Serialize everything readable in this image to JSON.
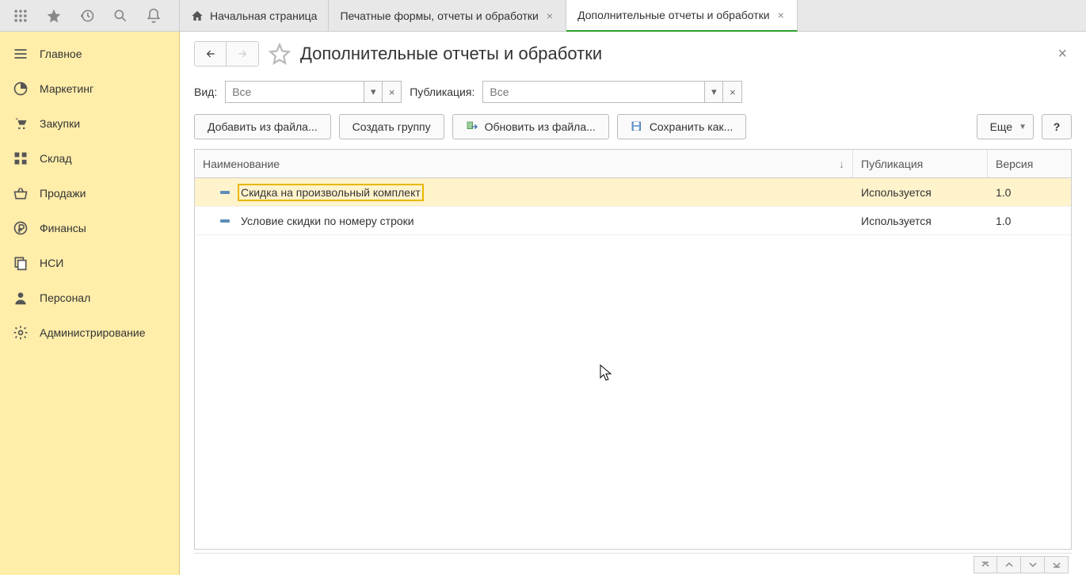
{
  "tabs": {
    "home": "Начальная страница",
    "print_forms": "Печатные формы, отчеты и обработки",
    "additional": "Дополнительные отчеты и обработки"
  },
  "sidebar": {
    "items": [
      {
        "label": "Главное"
      },
      {
        "label": "Маркетинг"
      },
      {
        "label": "Закупки"
      },
      {
        "label": "Склад"
      },
      {
        "label": "Продажи"
      },
      {
        "label": "Финансы"
      },
      {
        "label": "НСИ"
      },
      {
        "label": "Персонал"
      },
      {
        "label": "Администрирование"
      }
    ]
  },
  "page": {
    "title": "Дополнительные отчеты и обработки"
  },
  "filters": {
    "type_label": "Вид:",
    "type_placeholder": "Все",
    "pub_label": "Публикация:",
    "pub_placeholder": "Все"
  },
  "actions": {
    "add_from_file": "Добавить из файла...",
    "create_group": "Создать группу",
    "update_from_file": "Обновить из файла...",
    "save_as": "Сохранить как...",
    "more": "Еще",
    "help": "?"
  },
  "grid": {
    "columns": {
      "name": "Наименование",
      "publication": "Публикация",
      "version": "Версия"
    },
    "rows": [
      {
        "name": "Скидка на произвольный комплект",
        "publication": "Используется",
        "version": "1.0",
        "selected": true
      },
      {
        "name": "Условие скидки по номеру строки",
        "publication": "Используется",
        "version": "1.0",
        "selected": false
      }
    ]
  }
}
